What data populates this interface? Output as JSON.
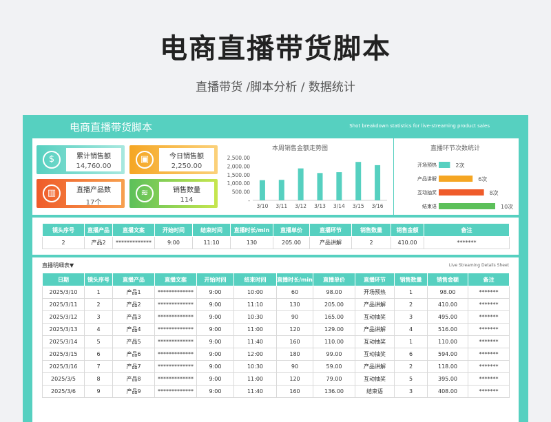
{
  "header": {
    "title": "电商直播带货脚本",
    "subtitle": "直播带货  /脚本分析 / 数据统计"
  },
  "sheet": {
    "title": "电商直播带货脚本",
    "subtitle_en": "Shot breakdown statistics for live-streaming product sales"
  },
  "kpis": [
    {
      "label": "累计销售额",
      "value": "14,760.00",
      "icon": "dollar-icon",
      "color": "#56d0c0"
    },
    {
      "label": "今日销售额",
      "value": "2,250.00",
      "icon": "wallet-icon",
      "color": "#f5a623"
    },
    {
      "label": "直播产品数",
      "value": "17个",
      "icon": "bar-chart-icon",
      "color": "#ef5b2a"
    },
    {
      "label": "销售数量",
      "value": "114",
      "icon": "stack-icon",
      "color": "#5cc05a"
    }
  ],
  "chart_data": [
    {
      "type": "bar",
      "title": "本周销售金额走势图",
      "categories": [
        "3/10",
        "3/11",
        "3/12",
        "3/13",
        "3/14",
        "3/15",
        "3/16"
      ],
      "values": [
        1180,
        1200,
        1870,
        1600,
        1650,
        2250,
        2060
      ],
      "ylim": [
        0,
        2500
      ],
      "yticks": [
        "2,500.00",
        "2,000.00",
        "1,500.00",
        "1,000.00",
        "500.00",
        "-"
      ],
      "color": "#56d0c0"
    },
    {
      "type": "bar",
      "orientation": "horizontal",
      "title": "直播环节次数统计",
      "categories": [
        "开场预热",
        "产品讲解",
        "互动抽奖",
        "结束语"
      ],
      "values": [
        2,
        6,
        8,
        10
      ],
      "value_labels": [
        "2次",
        "6次",
        "8次",
        "10次"
      ],
      "xlim": [
        0,
        10
      ],
      "colors": [
        "#56d0c0",
        "#f5a623",
        "#ef5b2a",
        "#5cc05a"
      ]
    }
  ],
  "current": {
    "headers": [
      "镜头序号",
      "直播产品",
      "直播文案",
      "开始时间",
      "结束时间",
      "直播时长/min",
      "直播单价",
      "直播环节",
      "销售数量",
      "销售金额",
      "备注"
    ],
    "row": [
      "2",
      "产品2",
      "*************",
      "9:00",
      "11:10",
      "130",
      "205.00",
      "产品讲解",
      "2",
      "410.00",
      "*******"
    ]
  },
  "detail": {
    "label": "直播明细表▼",
    "label_en": "Live Streaming Details Sheet",
    "headers": [
      "日期",
      "镜头序号",
      "直播产品",
      "直播文案",
      "开始时间",
      "结束时间",
      "直播时长/min",
      "直播单价",
      "直播环节",
      "销售数量",
      "销售金额",
      "备注"
    ],
    "rows": [
      [
        "2025/3/10",
        "1",
        "产品1",
        "*************",
        "9:00",
        "10:00",
        "60",
        "98.00",
        "开场预热",
        "1",
        "98.00",
        "*******"
      ],
      [
        "2025/3/11",
        "2",
        "产品2",
        "*************",
        "9:00",
        "11:10",
        "130",
        "205.00",
        "产品讲解",
        "2",
        "410.00",
        "*******"
      ],
      [
        "2025/3/12",
        "3",
        "产品3",
        "*************",
        "9:00",
        "10:30",
        "90",
        "165.00",
        "互动抽奖",
        "3",
        "495.00",
        "*******"
      ],
      [
        "2025/3/13",
        "4",
        "产品4",
        "*************",
        "9:00",
        "11:00",
        "120",
        "129.00",
        "产品讲解",
        "4",
        "516.00",
        "*******"
      ],
      [
        "2025/3/14",
        "5",
        "产品5",
        "*************",
        "9:00",
        "11:40",
        "160",
        "110.00",
        "互动抽奖",
        "1",
        "110.00",
        "*******"
      ],
      [
        "2025/3/15",
        "6",
        "产品6",
        "*************",
        "9:00",
        "12:00",
        "180",
        "99.00",
        "互动抽奖",
        "6",
        "594.00",
        "*******"
      ],
      [
        "2025/3/16",
        "7",
        "产品7",
        "*************",
        "9:00",
        "10:30",
        "90",
        "59.00",
        "产品讲解",
        "2",
        "118.00",
        "*******"
      ],
      [
        "2025/3/5",
        "8",
        "产品8",
        "*************",
        "9:00",
        "11:00",
        "120",
        "79.00",
        "互动抽奖",
        "5",
        "395.00",
        "*******"
      ],
      [
        "2025/3/6",
        "9",
        "产品9",
        "*************",
        "9:00",
        "11:40",
        "160",
        "136.00",
        "结束语",
        "3",
        "408.00",
        "*******"
      ]
    ]
  }
}
